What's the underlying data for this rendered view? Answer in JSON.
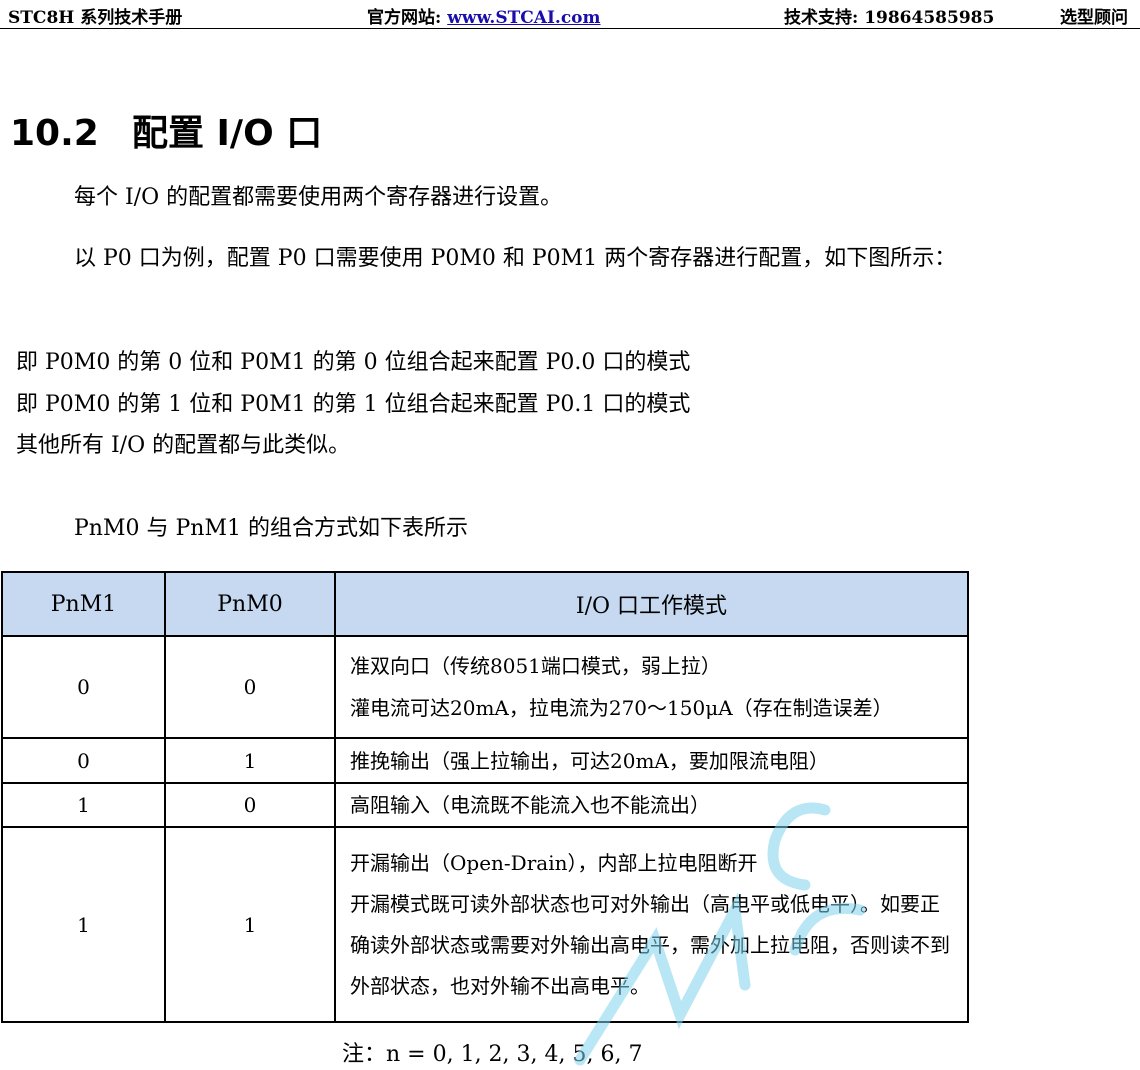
{
  "header": {
    "manual": "STC8H 系列技术手册",
    "website_label": "官方网站: ",
    "website": "www.STCAI.com",
    "support": "技术支持: 19864585985",
    "consult": "选型顾问"
  },
  "section": {
    "number": "10.2",
    "title": "配置 I/O 口"
  },
  "paragraphs": {
    "p1": "每个 I/O 的配置都需要使用两个寄存器进行设置。",
    "p2": "以 P0 口为例，配置 P0 口需要使用 P0M0 和 P0M1 两个寄存器进行配置，如下图所示：",
    "p3": "即 P0M0 的第 0 位和 P0M1 的第 0 位组合起来配置 P0.0 口的模式",
    "p4": "即 P0M0 的第 1 位和 P0M1 的第 1 位组合起来配置 P0.1 口的模式",
    "p5": "其他所有 I/O 的配置都与此类似。",
    "p6": "PnM0 与 PnM1 的组合方式如下表所示"
  },
  "table": {
    "headers": [
      "PnM1",
      "PnM0",
      "I/O 口工作模式"
    ],
    "rows": [
      {
        "m1": "0",
        "m0": "0",
        "lines": [
          "准双向口（传统8051端口模式，弱上拉）",
          "灌电流可达20mA，拉电流为270～150μA（存在制造误差）"
        ]
      },
      {
        "m1": "0",
        "m0": "1",
        "lines": [
          "推挽输出（强上拉输出，可达20mA，要加限流电阻）"
        ]
      },
      {
        "m1": "1",
        "m0": "0",
        "lines": [
          "高阻输入（电流既不能流入也不能流出）"
        ]
      },
      {
        "m1": "1",
        "m0": "1",
        "lines": [
          "开漏输出（Open-Drain），内部上拉电阻断开",
          "开漏模式既可读外部状态也可对外输出（高电平或低电平）。如要正确读外部状态或需要对外输出高电平，需外加上拉电阻，否则读不到外部状态，也对外输不出高电平。"
        ]
      }
    ]
  },
  "note": "注：n = 0, 1, 2, 3, 4, 5, 6, 7",
  "watermark": {
    "color": "#7fd3ee",
    "icon": "stcmcu-watermark"
  }
}
